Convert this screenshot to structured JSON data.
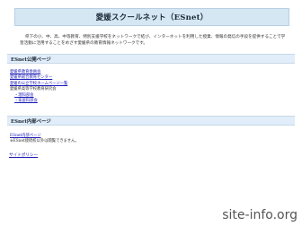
{
  "header": {
    "title": "愛媛スクールネット（ESnet）"
  },
  "intro": {
    "text": "県下の小、中、高、中等教育、特別支援学校をネットワークで結び、インターネットを利用した授業、情報の発信の手段を提供することで学習活動に活用することをめざす愛媛県の教育情報ネットワークです。"
  },
  "public_section": {
    "title": "ESnet公開ページ",
    "items": [
      {
        "label": "愛媛県教育委員会",
        "link": true,
        "indent": false
      },
      {
        "label": "愛媛県総合教育センター",
        "link": true,
        "indent": false
      },
      {
        "label": "愛媛の公立学校ホームページ一覧",
        "link": true,
        "indent": false
      },
      {
        "label": "愛媛県高等学校教育研究会",
        "link": false,
        "indent": false
      },
      {
        "label": "・理科部会",
        "link": true,
        "indent": true
      },
      {
        "label": "・家庭科部会",
        "link": true,
        "indent": true
      }
    ]
  },
  "internal_section": {
    "title": "ESnet内部ページ",
    "link_label": "ESnet内部ページ",
    "note": "※ESnet接続校以外は閲覧できません。"
  },
  "footer": {
    "policy_label": "サイトポリシー"
  },
  "watermark": {
    "text": "site-info.org"
  }
}
